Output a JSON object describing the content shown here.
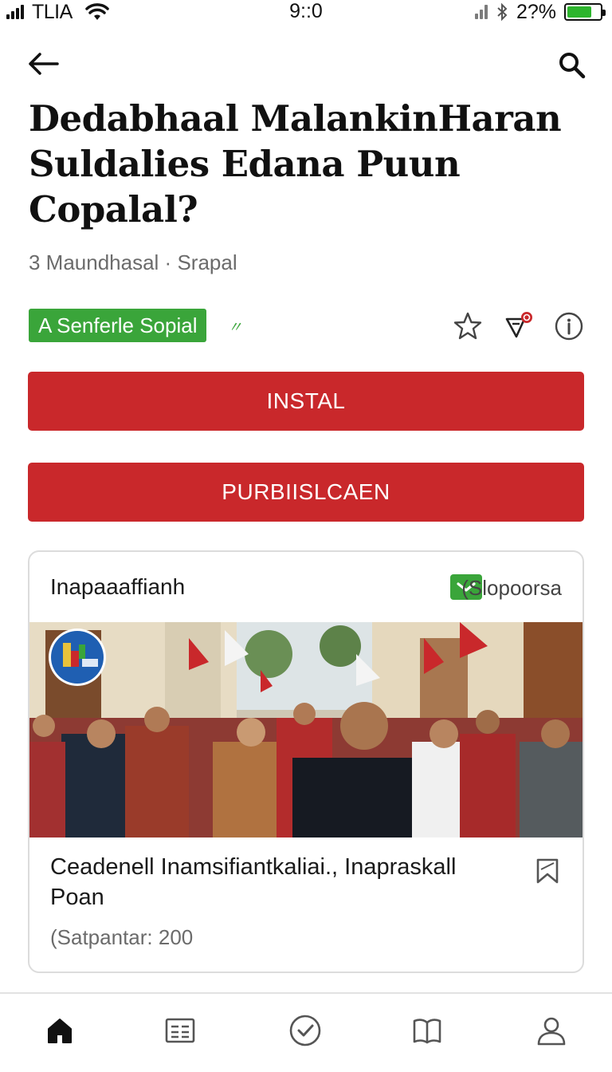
{
  "status_bar": {
    "carrier": "TLIA",
    "time": "9::0",
    "battery_pct": "2?%",
    "battery_level": 0.75,
    "battery_color": "#2db52d"
  },
  "topbar": {
    "back_icon": "arrow-left-icon",
    "search_icon": "search-icon"
  },
  "article": {
    "headline_lines": [
      "Dedabhaal MalankinHaran",
      "Suldalies Edana Puun",
      "Copalal?"
    ],
    "meta": "3 Maundhasal · Srapal",
    "tag": "A Senferle Sopial",
    "tag_color": "#3aa53a",
    "action_icons": [
      "star-icon",
      "tag-notification-icon",
      "info-icon"
    ]
  },
  "buttons": {
    "install": "INSTAL",
    "publish": "PURBIISLCAEN",
    "color": "#c9282b"
  },
  "card": {
    "title": "Inapaaaffianh",
    "sponsor": "(Slopoorsa",
    "badge_icon": "chevron-down-icon",
    "story_title": "Ceadenell Inamsifiantkaliai., Inapraskall Poan",
    "story_meta": "(Satpantar: 200",
    "bookmark_icon": "bookmark-icon"
  },
  "bottom_nav": {
    "items": [
      {
        "icon": "home-icon",
        "active": true
      },
      {
        "icon": "news-icon",
        "active": false
      },
      {
        "icon": "check-circle-icon",
        "active": false
      },
      {
        "icon": "book-icon",
        "active": false
      },
      {
        "icon": "profile-icon",
        "active": false
      }
    ]
  }
}
